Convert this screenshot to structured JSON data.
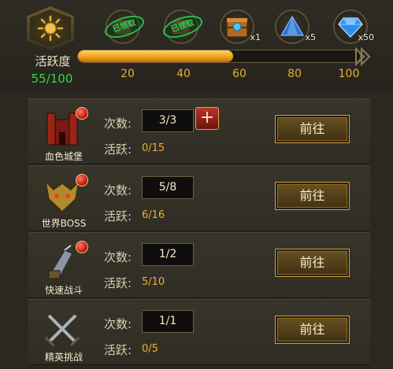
{
  "activity": {
    "title": "活跃度",
    "score": "55/100",
    "progress_fraction": 0.55,
    "badge_icon": "sun-icon"
  },
  "milestones": [
    "20",
    "40",
    "60",
    "80",
    "100"
  ],
  "rewards": [
    {
      "status": "已领取",
      "icon": "chest-icon",
      "count": ""
    },
    {
      "status": "已领取",
      "icon": "chest-icon",
      "count": ""
    },
    {
      "status": "",
      "icon": "wooden-chest-icon",
      "count": "x1"
    },
    {
      "status": "",
      "icon": "blue-crystal-icon",
      "count": "x5"
    },
    {
      "status": "",
      "icon": "diamond-icon",
      "count": "x50"
    }
  ],
  "labels": {
    "count": "次数:",
    "active": "活跃:",
    "go": "前往",
    "plus": "+"
  },
  "tasks": [
    {
      "name": "血色城堡",
      "icon": "castle-icon",
      "count": "3/3",
      "active": "0/15",
      "has_plus": true,
      "has_dot": true
    },
    {
      "name": "世界BOSS",
      "icon": "boss-mask-icon",
      "count": "5/8",
      "active": "6/16",
      "has_plus": false,
      "has_dot": true
    },
    {
      "name": "快速战斗",
      "icon": "gauntlet-icon",
      "count": "1/2",
      "active": "5/10",
      "has_plus": false,
      "has_dot": true
    },
    {
      "name": "精英挑战",
      "icon": "crossed-swords-icon",
      "count": "1/1",
      "active": "0/5",
      "has_plus": false,
      "has_dot": false
    }
  ],
  "colors": {
    "accent_gold": "#e8b22e",
    "score_green": "#39d84a",
    "claimed_green": "#34d055"
  }
}
